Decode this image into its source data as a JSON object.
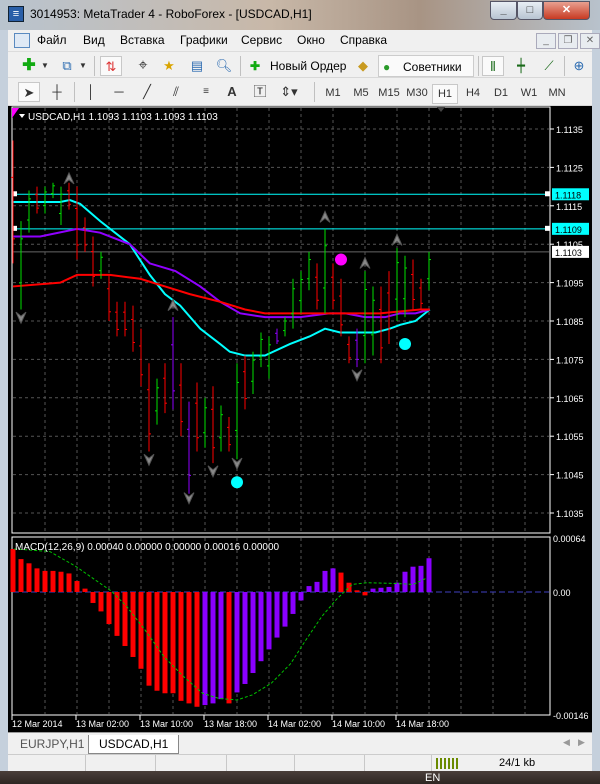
{
  "window": {
    "title": "3014953: MetaTrader 4 - RoboForex - [USDCAD,H1]",
    "app_icon": "metatrader-icon"
  },
  "menu": [
    "Файл",
    "Вид",
    "Вставка",
    "Графики",
    "Сервис",
    "Окно",
    "Справка"
  ],
  "toolbar": {
    "new_order": "Новый Ордер",
    "experts": "Советники"
  },
  "drawing_tools": {
    "text_tool": "A"
  },
  "timeframes": [
    "M1",
    "M5",
    "M15",
    "M30",
    "H1",
    "H4",
    "D1",
    "W1",
    "MN"
  ],
  "active_timeframe": "H1",
  "chart_header": "USDCAD,H1  1.1093 1.1103 1.1093 1.1103",
  "macd_header": "MACD(12,26,9) 0.00040 0.00000 0.00000 0.00016 0.00000",
  "tabs": [
    "EURJPY,H1",
    "USDCAD,H1"
  ],
  "active_tab": "USDCAD,H1",
  "status": {
    "traffic": "24/1 kb"
  },
  "taskbar": {
    "lang": "EN"
  },
  "colors": {
    "up": "#00e000",
    "down": "#ff0000",
    "neutral": "#9000ff",
    "ma_fast": "#00ffff",
    "ma_mid": "#9000ff",
    "ma_slow": "#ff0000",
    "macd_up": "#8a00ff",
    "macd_down": "#ff0000",
    "signal": "#00c000",
    "grid": "#555555"
  },
  "chart_data": {
    "type": "ohlc",
    "symbol": "USDCAD",
    "timeframe": "H1",
    "price_ticks": [
      "1.1135",
      "1.1125",
      "1.1115",
      "1.1105",
      "1.1095",
      "1.1085",
      "1.1075",
      "1.1065",
      "1.1055",
      "1.1045",
      "1.1035"
    ],
    "price_range": [
      1.10315,
      1.1141
    ],
    "levels": [
      {
        "price": 1.1118,
        "label": "1.1118",
        "color": "#00ffff"
      },
      {
        "price": 1.1109,
        "label": "1.1109",
        "color": "#00ffff"
      },
      {
        "price": 1.1103,
        "label": "1.1103",
        "color": "#ffffff"
      }
    ],
    "bars": [
      [
        1.1132,
        1.11,
        "down"
      ],
      [
        1.1111,
        1.1088,
        "up"
      ],
      [
        1.1119,
        1.1108,
        "up"
      ],
      [
        1.112,
        1.1113,
        "down"
      ],
      [
        1.112,
        1.1113,
        "up"
      ],
      [
        1.1121,
        1.1117,
        "up"
      ],
      [
        1.112,
        1.111,
        "up"
      ],
      [
        1.1121,
        1.1114,
        "down"
      ],
      [
        1.112,
        1.1101,
        "down"
      ],
      [
        1.1112,
        1.1103,
        "down"
      ],
      [
        1.1107,
        1.1094,
        "down"
      ],
      [
        1.1103,
        1.1096,
        "up"
      ],
      [
        1.1097,
        1.1085,
        "down"
      ],
      [
        1.109,
        1.1081,
        "down"
      ],
      [
        1.109,
        1.1081,
        "down"
      ],
      [
        1.1089,
        1.1077,
        "down"
      ],
      [
        1.1083,
        1.1068,
        "down"
      ],
      [
        1.1074,
        1.1051,
        "down"
      ],
      [
        1.107,
        1.1058,
        "up"
      ],
      [
        1.1074,
        1.1061,
        "down"
      ],
      [
        1.1086,
        1.1062,
        "neutral"
      ],
      [
        1.1074,
        1.1055,
        "down"
      ],
      [
        1.1064,
        1.104,
        "neutral"
      ],
      [
        1.1069,
        1.1051,
        "down"
      ],
      [
        1.1065,
        1.1052,
        "up"
      ],
      [
        1.1068,
        1.1048,
        "down"
      ],
      [
        1.1063,
        1.1051,
        "up"
      ],
      [
        1.106,
        1.1051,
        "down"
      ],
      [
        1.1074,
        1.1049,
        "up"
      ],
      [
        1.1076,
        1.1062,
        "down"
      ],
      [
        1.1077,
        1.1066,
        "up"
      ],
      [
        1.1082,
        1.1073,
        "up"
      ],
      [
        1.1081,
        1.107,
        "up"
      ],
      [
        1.1083,
        1.1079,
        "neutral"
      ],
      [
        1.1086,
        1.1081,
        "up"
      ],
      [
        1.1096,
        1.1083,
        "up"
      ],
      [
        1.1098,
        1.1087,
        "up"
      ],
      [
        1.1103,
        1.1093,
        "up"
      ],
      [
        1.11,
        1.1088,
        "down"
      ],
      [
        1.1109,
        1.1087,
        "up"
      ],
      [
        1.11,
        1.1088,
        "down"
      ],
      [
        1.1096,
        1.1081,
        "down"
      ],
      [
        1.1081,
        1.1074,
        "down"
      ],
      [
        1.1083,
        1.1073,
        "neutral"
      ],
      [
        1.1098,
        1.1074,
        "up"
      ],
      [
        1.1094,
        1.1076,
        "up"
      ],
      [
        1.1094,
        1.1074,
        "down"
      ],
      [
        1.1098,
        1.1079,
        "down"
      ],
      [
        1.1104,
        1.1085,
        "up"
      ],
      [
        1.1102,
        1.1086,
        "up"
      ],
      [
        1.1101,
        1.1088,
        "down"
      ],
      [
        1.1096,
        1.1088,
        "down"
      ],
      [
        1.1103,
        1.1093,
        "up"
      ]
    ],
    "moving_averages": [
      {
        "name": "ma_fast",
        "color": "#00ffff",
        "points": [
          [
            0,
            1.1116
          ],
          [
            5.9,
            1.1116
          ],
          [
            7.1,
            1.11165
          ],
          [
            8.4,
            1.11155
          ],
          [
            10.9,
            1.1111
          ],
          [
            14.6,
            1.1105
          ],
          [
            17.1,
            1.1097
          ],
          [
            19,
            1.1092
          ],
          [
            20.9,
            1.1089
          ],
          [
            23.4,
            1.1083
          ],
          [
            25.9,
            1.1079
          ],
          [
            27.1,
            1.1077
          ],
          [
            29,
            1.1076
          ],
          [
            31.5,
            1.1076
          ],
          [
            34.6,
            1.1079
          ],
          [
            37.1,
            1.1081
          ],
          [
            39,
            1.1083
          ],
          [
            40.9,
            1.1082
          ],
          [
            43.4,
            1.1082
          ],
          [
            45.3,
            1.1082
          ],
          [
            47.1,
            1.1083
          ],
          [
            48.4,
            1.1084
          ],
          [
            50.3,
            1.1085
          ],
          [
            52.1,
            1.1088
          ]
        ]
      },
      {
        "name": "ma_mid",
        "color": "#9000ff",
        "points": [
          [
            0,
            1.1107
          ],
          [
            3.4,
            1.1107
          ],
          [
            8,
            1.1109
          ],
          [
            10.9,
            1.1108
          ],
          [
            14.6,
            1.1105
          ],
          [
            17.1,
            1.11
          ],
          [
            20.3,
            1.1098
          ],
          [
            23.4,
            1.1094
          ],
          [
            25.9,
            1.109
          ],
          [
            28.4,
            1.1087
          ],
          [
            31.5,
            1.1086
          ],
          [
            34.6,
            1.1086
          ],
          [
            35.9,
            1.1086
          ],
          [
            39.6,
            1.1087
          ],
          [
            41.5,
            1.1087
          ],
          [
            44,
            1.1086
          ],
          [
            46.5,
            1.1086
          ],
          [
            48.4,
            1.1087
          ],
          [
            50.3,
            1.1087
          ],
          [
            52.1,
            1.1088
          ]
        ]
      },
      {
        "name": "ma_slow",
        "color": "#ff0000",
        "points": [
          [
            0,
            1.1094
          ],
          [
            5.9,
            1.1095
          ],
          [
            8,
            1.1097
          ],
          [
            12.1,
            1.1097
          ],
          [
            15.9,
            1.1096
          ],
          [
            19,
            1.1094
          ],
          [
            22.1,
            1.1092
          ],
          [
            25.9,
            1.109
          ],
          [
            29,
            1.1088
          ],
          [
            31.5,
            1.1087
          ],
          [
            35.9,
            1.1087
          ],
          [
            40.9,
            1.1087
          ],
          [
            45.9,
            1.1087
          ],
          [
            50.9,
            1.1088
          ],
          [
            52.1,
            1.1088
          ]
        ]
      }
    ],
    "fractal_arrows": [
      {
        "bar": 7,
        "price": 1.1122,
        "dir": "up"
      },
      {
        "bar": 20,
        "price": 1.1089,
        "dir": "up"
      },
      {
        "bar": 39,
        "price": 1.1112,
        "dir": "up"
      },
      {
        "bar": 44,
        "price": 1.11,
        "dir": "up"
      },
      {
        "bar": 48,
        "price": 1.1106,
        "dir": "up"
      },
      {
        "bar": 1,
        "price": 1.1086,
        "dir": "down"
      },
      {
        "bar": 17,
        "price": 1.1049,
        "dir": "down"
      },
      {
        "bar": 22,
        "price": 1.1039,
        "dir": "down"
      },
      {
        "bar": 25,
        "price": 1.1046,
        "dir": "down"
      },
      {
        "bar": 28,
        "price": 1.1048,
        "dir": "down"
      },
      {
        "bar": 43,
        "price": 1.1071,
        "dir": "down"
      }
    ],
    "signal_dots": [
      {
        "bar": 41,
        "price": 1.1101,
        "color": "#ff00ff"
      },
      {
        "bar": 49,
        "price": 1.1079,
        "color": "#00ffff"
      },
      {
        "bar": 28,
        "price": 1.1043,
        "color": "#00ffff"
      }
    ],
    "time_labels": [
      {
        "bar": 0,
        "label": "12 Mar 2014"
      },
      {
        "bar": 8,
        "label": "13 Mar 02:00"
      },
      {
        "bar": 16,
        "label": "13 Mar 10:00"
      },
      {
        "bar": 24,
        "label": "13 Mar 18:00"
      },
      {
        "bar": 32,
        "label": "14 Mar 02:00"
      },
      {
        "bar": 40,
        "label": "14 Mar 10:00"
      },
      {
        "bar": 48,
        "label": "14 Mar 18:00"
      }
    ],
    "macd": {
      "ticks": [
        {
          "value": 0.00064,
          "label": "0.00064"
        },
        {
          "value": 0,
          "label": "0.00"
        },
        {
          "value": -0.00146,
          "label": "-0.00146"
        }
      ],
      "range": [
        -0.00146,
        0.00064
      ],
      "histogram": [
        0.00051,
        0.00039,
        0.00034,
        0.00028,
        0.00025,
        0.00025,
        0.00024,
        0.00022,
        0.00013,
        4e-05,
        -0.00013,
        -0.00023,
        -0.00038,
        -0.00052,
        -0.00064,
        -0.00077,
        -0.00091,
        -0.00111,
        -0.00117,
        -0.0012,
        -0.0012,
        -0.00129,
        -0.00132,
        -0.00136,
        -0.00134,
        -0.00132,
        -0.00127,
        -0.00132,
        -0.00119,
        -0.00109,
        -0.00096,
        -0.00082,
        -0.00068,
        -0.00054,
        -0.00041,
        -0.00026,
        -0.0001,
        7e-05,
        0.00012,
        0.00025,
        0.00028,
        0.00023,
        0.00011,
        2e-05,
        -4e-05,
        4e-05,
        5e-05,
        6e-05,
        0.00011,
        0.00024,
        0.0003,
        0.00031,
        0.0004
      ],
      "histogram_colors": [
        "down",
        "down",
        "down",
        "down",
        "down",
        "down",
        "down",
        "down",
        "down",
        "down",
        "down",
        "down",
        "down",
        "down",
        "down",
        "down",
        "down",
        "down",
        "down",
        "down",
        "down",
        "down",
        "down",
        "down",
        "up",
        "up",
        "up",
        "down",
        "up",
        "up",
        "up",
        "up",
        "up",
        "up",
        "up",
        "up",
        "up",
        "up",
        "up",
        "up",
        "up",
        "down",
        "down",
        "down",
        "down",
        "up",
        "up",
        "up",
        "up",
        "up",
        "up",
        "up",
        "up"
      ],
      "signal": [
        [
          0.15,
          0.00051
        ],
        [
          4.6,
          0.00048
        ],
        [
          7.9,
          0.0003
        ],
        [
          12.3,
          1e-05
        ],
        [
          14.2,
          -0.00017
        ],
        [
          16.5,
          -0.00045
        ],
        [
          18.9,
          -0.00077
        ],
        [
          21.3,
          -0.001
        ],
        [
          23.7,
          -0.0012
        ],
        [
          25.7,
          -0.00126
        ],
        [
          28,
          -0.00128
        ],
        [
          29.9,
          -0.00122
        ],
        [
          32.3,
          -0.00108
        ],
        [
          34.7,
          -0.00085
        ],
        [
          36.6,
          -0.00057
        ],
        [
          38.6,
          -0.00029
        ],
        [
          40.5,
          -8e-05
        ],
        [
          42.4,
          9e-05
        ],
        [
          44.3,
          0.00011
        ],
        [
          48.1,
          0.0001
        ],
        [
          50,
          9e-05
        ],
        [
          51.6,
          0.00016
        ]
      ]
    }
  }
}
